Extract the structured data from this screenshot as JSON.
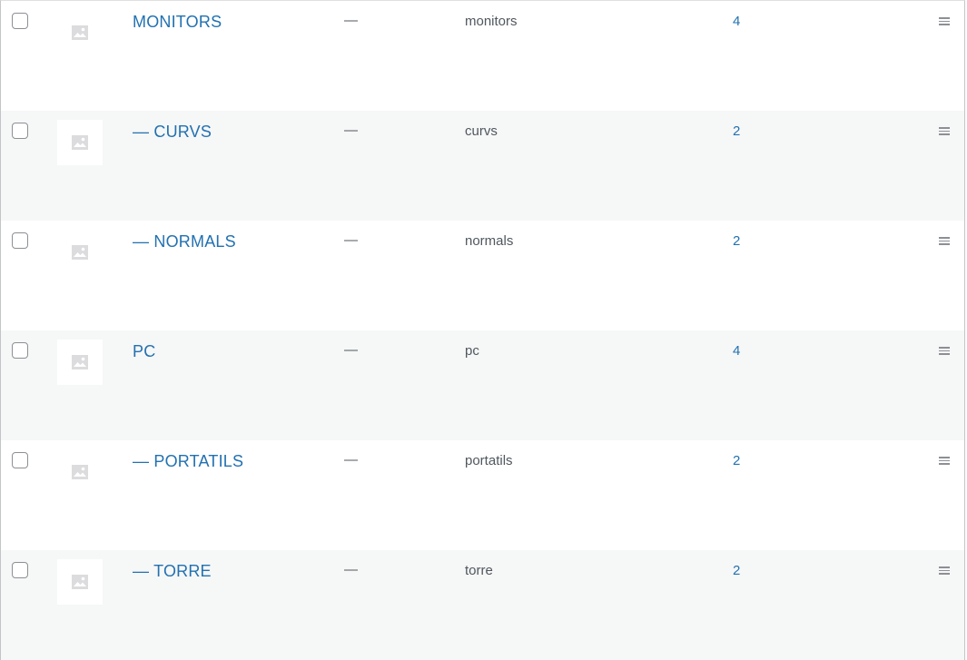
{
  "rows": [
    {
      "name": "MONITORS",
      "description": "—",
      "slug": "monitors",
      "count": "4"
    },
    {
      "name": "— CURVS",
      "description": "—",
      "slug": "curvs",
      "count": "2"
    },
    {
      "name": "— NORMALS",
      "description": "—",
      "slug": "normals",
      "count": "2"
    },
    {
      "name": "PC",
      "description": "—",
      "slug": "pc",
      "count": "4"
    },
    {
      "name": "— PORTATILS",
      "description": "—",
      "slug": "portatils",
      "count": "2"
    },
    {
      "name": "— TORRE",
      "description": "—",
      "slug": "torre",
      "count": "2"
    }
  ],
  "colors": {
    "link": "#2271b1",
    "text": "#50575e",
    "alt_row": "#f6f7f7",
    "border": "#c3c4c7"
  },
  "icons": {
    "thumbnail": "image-placeholder-icon",
    "drag": "drag-handle-icon"
  }
}
